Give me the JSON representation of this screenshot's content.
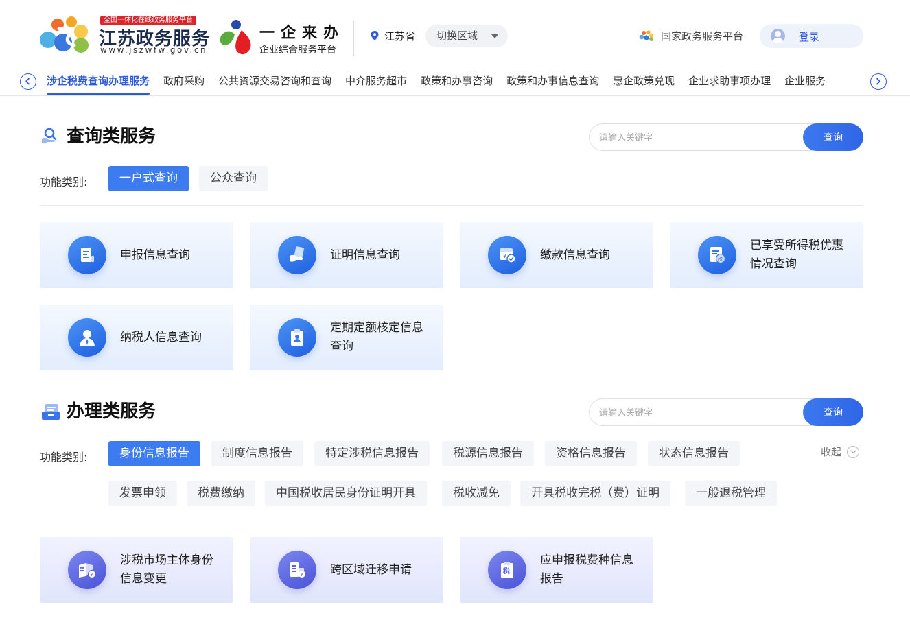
{
  "header": {
    "site_tagline": "全国一体化在线政务服务平台",
    "site_title": "江苏政务服务",
    "site_url": "www.jszwfw.gov.cn",
    "yq_title": "一企来办",
    "yq_subtitle": "企业综合服务平台",
    "location": "江苏省",
    "switch_region": "切换区域",
    "national_platform": "国家政务服务平台",
    "login": "登录"
  },
  "tabs": [
    {
      "label": "涉企税费查询办理服务",
      "active": true
    },
    {
      "label": "政府采购"
    },
    {
      "label": "公共资源交易咨询和查询"
    },
    {
      "label": "中介服务超市"
    },
    {
      "label": "政策和办事咨询"
    },
    {
      "label": "政策和办事信息查询"
    },
    {
      "label": "惠企政策兑现"
    },
    {
      "label": "企业求助事项办理"
    },
    {
      "label": "企业服务"
    }
  ],
  "query_section": {
    "title": "查询类服务",
    "search_placeholder": "请输入关键字",
    "search_button": "查询",
    "category_label": "功能类别:",
    "categories": [
      {
        "label": "一户式查询",
        "active": true
      },
      {
        "label": "公众查询"
      }
    ],
    "cards": [
      {
        "label": "申报信息查询",
        "icon": "document-icon"
      },
      {
        "label": "证明信息查询",
        "icon": "certificate-hand-icon"
      },
      {
        "label": "缴款信息查询",
        "icon": "payment-icon"
      },
      {
        "label": "已享受所得税优惠情况查询",
        "icon": "tax-document-icon"
      },
      {
        "label": "纳税人信息查询",
        "icon": "person-icon"
      },
      {
        "label": "定期定额核定信息查询",
        "icon": "clipboard-icon"
      }
    ]
  },
  "handle_section": {
    "title": "办理类服务",
    "search_placeholder": "请输入关键字",
    "search_button": "查询",
    "category_label": "功能类别:",
    "categories": [
      {
        "label": "身份信息报告",
        "active": true
      },
      {
        "label": "制度信息报告"
      },
      {
        "label": "特定涉税信息报告"
      },
      {
        "label": "税源信息报告"
      },
      {
        "label": "资格信息报告"
      },
      {
        "label": "状态信息报告"
      },
      {
        "label": "发票申领"
      },
      {
        "label": "税费缴纳"
      },
      {
        "label": "中国税收居民身份证明开具"
      },
      {
        "label": "税收减免"
      },
      {
        "label": "开具税收完税（费）证明"
      },
      {
        "label": "一般退税管理"
      }
    ],
    "collapse_label": "收起",
    "cards": [
      {
        "label": "涉税市场主体身份信息变更",
        "icon": "id-change-icon"
      },
      {
        "label": "跨区域迁移申请",
        "icon": "migration-icon"
      },
      {
        "label": "应申报税费种信息报告",
        "icon": "tax-clipboard-icon"
      }
    ]
  },
  "colors": {
    "brand_blue": "#2e5bde",
    "chip_active": "#3c7cf0",
    "brand_red": "#d9252b"
  }
}
